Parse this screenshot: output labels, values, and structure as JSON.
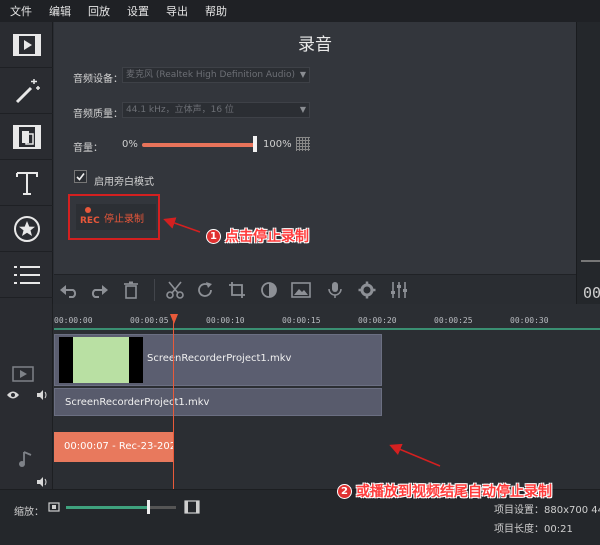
{
  "menu": [
    "文件",
    "编辑",
    "回放",
    "设置",
    "导出",
    "帮助"
  ],
  "tools": [
    {
      "icon": "film-icon"
    },
    {
      "icon": "magic-wand-icon"
    },
    {
      "icon": "transition-icon"
    },
    {
      "icon": "text-icon"
    },
    {
      "icon": "sticker-star-icon"
    },
    {
      "icon": "list-icon"
    }
  ],
  "panel": {
    "title": "录音",
    "device_label": "音频设备：",
    "device_value": "麦克风 (Realtek High Definition Audio)",
    "quality_label": "音频质量：",
    "quality_value": "44.1 kHz，立体声，16 位",
    "volume_label": "音量：",
    "volume_min": "0%",
    "volume_max": "100%",
    "volume_level": 1.0,
    "voiceover_label": "启用旁白模式",
    "voiceover_checked": true,
    "rec_icon_text": "REC",
    "stop_label": "停止录制"
  },
  "right_timecode": "00",
  "ruler": [
    "00:00:00",
    "00:00:05",
    "00:00:10",
    "00:00:15",
    "00:00:20",
    "00:00:25",
    "00:00:30"
  ],
  "clips": {
    "video_name": "ScreenRecorderProject1.mkv",
    "audio_name": "ScreenRecorderProject1.mkv",
    "recording_name": "00:00:07 - Rec-23-202"
  },
  "bottom": {
    "zoom_label": "缩放：",
    "zoom_level": 0.75,
    "project_settings": "项目设置：880x700 44:",
    "project_length": "项目长度：00:21"
  },
  "annotations": {
    "one_number": "1",
    "one_text": "点击停止录制",
    "two_number": "2",
    "two_text": "或播放到视频结尾自动停止录制"
  },
  "colors": {
    "accent": "#e8735a",
    "highlight_red": "#d42020",
    "timeline_green": "#3a8f72"
  }
}
